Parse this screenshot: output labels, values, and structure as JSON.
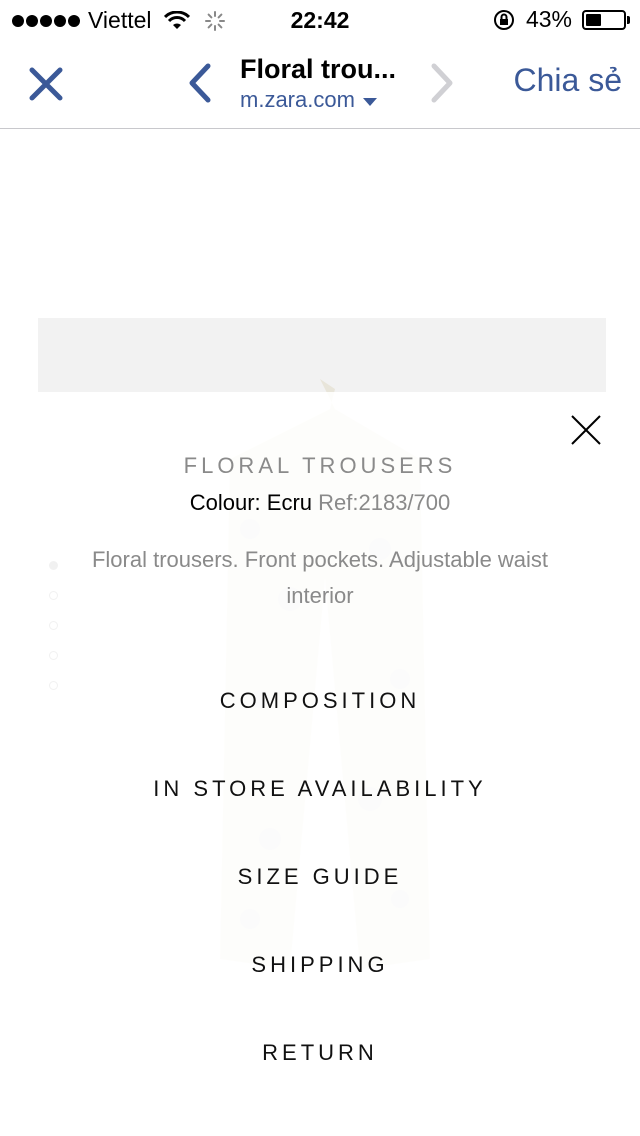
{
  "status_bar": {
    "carrier": "Viettel",
    "time": "22:42",
    "battery_percent": "43%",
    "battery_level": 0.43
  },
  "nav": {
    "title": "Floral trou...",
    "url": "m.zara.com",
    "share_label": "Chia sẻ",
    "accent_color": "#3b5998"
  },
  "product": {
    "name": "FLORAL TROUSERS",
    "colour_label": "Colour: Ecru",
    "ref": "Ref:2183/700",
    "description": "Floral trousers. Front pockets. Adjustable waist interior"
  },
  "menu": [
    {
      "label": "COMPOSITION"
    },
    {
      "label": "IN STORE AVAILABILITY"
    },
    {
      "label": "SIZE GUIDE"
    },
    {
      "label": "SHIPPING"
    },
    {
      "label": "RETURN"
    }
  ],
  "gallery": {
    "count": 5,
    "active_index": 0
  }
}
